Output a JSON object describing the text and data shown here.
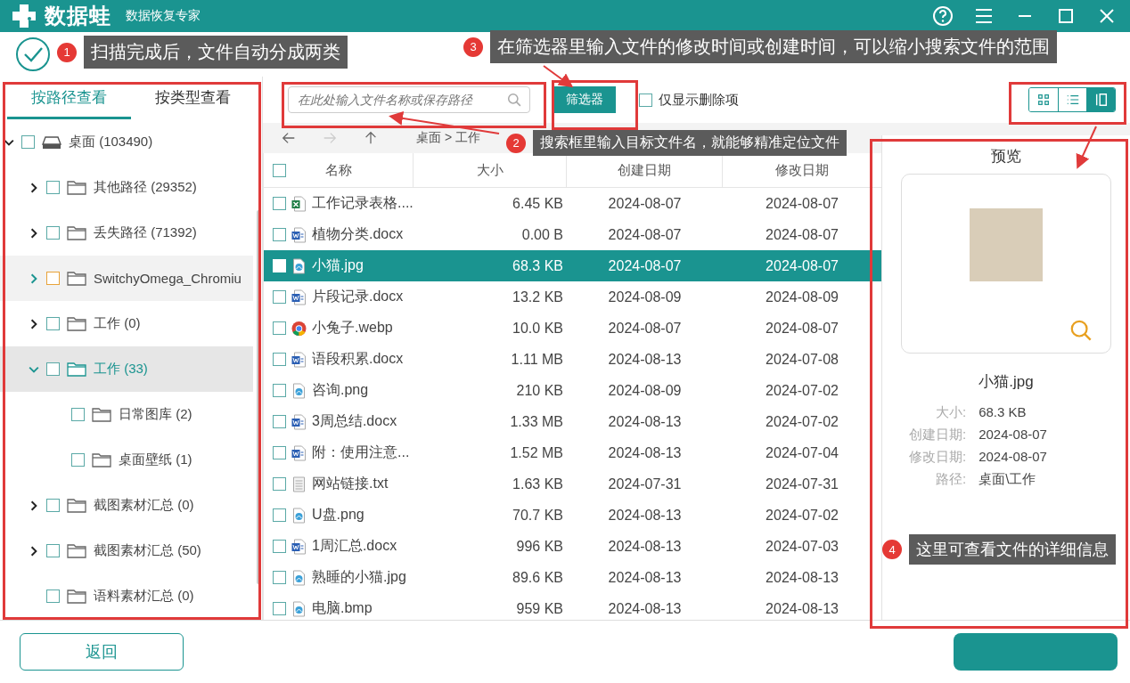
{
  "app": {
    "name": "数据蛙",
    "subtitle": "数据恢复专家"
  },
  "view_tabs": [
    {
      "label": "按路径查看",
      "selected": true
    },
    {
      "label": "按类型查看",
      "selected": false
    }
  ],
  "tree": [
    {
      "label": "桌面 (103490)",
      "kind": "drive",
      "checked": false,
      "expanded": true,
      "selected": false,
      "highlighted": false,
      "children": [
        {
          "label": "其他路径 (29352)",
          "kind": "folder",
          "checked": false,
          "expanded": false,
          "selected": false,
          "highlighted": false
        },
        {
          "label": "丢失路径 (71392)",
          "kind": "folder",
          "checked": false,
          "expanded": false,
          "selected": false,
          "highlighted": false
        },
        {
          "label": "SwitchyOmega_Chromiu",
          "kind": "folder",
          "checked": false,
          "expanded": false,
          "selected": false,
          "highlighted": true
        },
        {
          "label": "工作 (0)",
          "kind": "folder",
          "checked": false,
          "expanded": false,
          "selected": false,
          "highlighted": false
        },
        {
          "label": "工作 (33)",
          "kind": "folder",
          "checked": false,
          "expanded": true,
          "selected": true,
          "highlighted": false,
          "children": [
            {
              "label": "日常图库 (2)",
              "kind": "folder",
              "checked": false,
              "selected": false,
              "highlighted": false
            },
            {
              "label": "桌面壁纸 (1)",
              "kind": "folder",
              "checked": false,
              "selected": false,
              "highlighted": false
            }
          ]
        },
        {
          "label": "截图素材汇总 (0)",
          "kind": "folder",
          "checked": false,
          "expanded": false,
          "selected": false,
          "highlighted": false
        },
        {
          "label": "截图素材汇总 (50)",
          "kind": "folder",
          "checked": false,
          "expanded": false,
          "selected": false,
          "highlighted": false
        },
        {
          "label": "语料素材汇总 (0)",
          "kind": "folder",
          "checked": false,
          "selected": false,
          "highlighted": false
        }
      ]
    }
  ],
  "search": {
    "placeholder": "在此处输入文件名称或保存路径"
  },
  "filter_button": "筛选器",
  "deleted_only": {
    "label": "仅显示删除项",
    "checked": false
  },
  "view_modes": [
    {
      "kind": "grid",
      "selected": false
    },
    {
      "kind": "list",
      "selected": false
    },
    {
      "kind": "panel",
      "selected": true
    }
  ],
  "breadcrumb": "桌面 > 工作",
  "table": {
    "all_checked": false,
    "columns": [
      "名称",
      "大小",
      "创建日期",
      "修改日期"
    ],
    "rows": [
      {
        "kind": "spreadsheet",
        "name": "工作记录表格....",
        "size": "6.45 KB",
        "created": "2024-08-07",
        "modified": "2024-08-07",
        "checked": false,
        "selected": false
      },
      {
        "kind": "document",
        "name": "植物分类.docx",
        "size": "0.00  B",
        "created": "2024-08-07",
        "modified": "2024-08-07",
        "checked": false,
        "selected": false
      },
      {
        "kind": "image",
        "name": "小猫.jpg",
        "size": "68.3 KB",
        "created": "2024-08-07",
        "modified": "2024-08-07",
        "checked": false,
        "selected": true
      },
      {
        "kind": "document",
        "name": "片段记录.docx",
        "size": "13.2 KB",
        "created": "2024-08-09",
        "modified": "2024-08-09",
        "checked": false,
        "selected": false
      },
      {
        "kind": "browser",
        "name": "小兔子.webp",
        "size": "10.0 KB",
        "created": "2024-08-07",
        "modified": "2024-08-07",
        "checked": false,
        "selected": false
      },
      {
        "kind": "document",
        "name": "语段积累.docx",
        "size": "1.11 MB",
        "created": "2024-08-13",
        "modified": "2024-07-08",
        "checked": false,
        "selected": false
      },
      {
        "kind": "image",
        "name": "咨询.png",
        "size": "210 KB",
        "created": "2024-08-09",
        "modified": "2024-07-02",
        "checked": false,
        "selected": false
      },
      {
        "kind": "document",
        "name": "3周总结.docx",
        "size": "1.33 MB",
        "created": "2024-08-13",
        "modified": "2024-07-02",
        "checked": false,
        "selected": false
      },
      {
        "kind": "document",
        "name": "附：使用注意...",
        "size": "1.52 MB",
        "created": "2024-08-13",
        "modified": "2024-07-04",
        "checked": false,
        "selected": false
      },
      {
        "kind": "text",
        "name": "网站链接.txt",
        "size": "1.63 KB",
        "created": "2024-07-31",
        "modified": "2024-07-31",
        "checked": false,
        "selected": false
      },
      {
        "kind": "image",
        "name": "U盘.png",
        "size": "70.7 KB",
        "created": "2024-08-13",
        "modified": "2024-07-02",
        "checked": false,
        "selected": false
      },
      {
        "kind": "document",
        "name": "1周汇总.docx",
        "size": "996 KB",
        "created": "2024-08-13",
        "modified": "2024-07-03",
        "checked": false,
        "selected": false
      },
      {
        "kind": "image",
        "name": "熟睡的小猫.jpg",
        "size": "89.6 KB",
        "created": "2024-08-13",
        "modified": "2024-08-13",
        "checked": false,
        "selected": false
      },
      {
        "kind": "image",
        "name": "电脑.bmp",
        "size": "959 KB",
        "created": "2024-08-13",
        "modified": "2024-08-13",
        "checked": false,
        "selected": false
      }
    ]
  },
  "preview": {
    "title": "预览",
    "file_name": "小猫.jpg",
    "details": [
      {
        "label": "大小:",
        "value": "68.3 KB"
      },
      {
        "label": "创建日期:",
        "value": "2024-08-07"
      },
      {
        "label": "修改日期:",
        "value": "2024-08-07"
      },
      {
        "label": "路径:",
        "value": "桌面\\工作"
      }
    ]
  },
  "back_button": "返回",
  "annotations": [
    {
      "number": "1",
      "text": "扫描完成后，文件自动分成两类"
    },
    {
      "number": "2",
      "text": "搜索框里输入目标文件名，就能够精准定位文件"
    },
    {
      "number": "3",
      "text": "在筛选器里输入文件的修改时间或创建时间，可以缩小搜索文件的范围"
    },
    {
      "number": "4",
      "text": "这里可查看文件的详细信息"
    }
  ]
}
